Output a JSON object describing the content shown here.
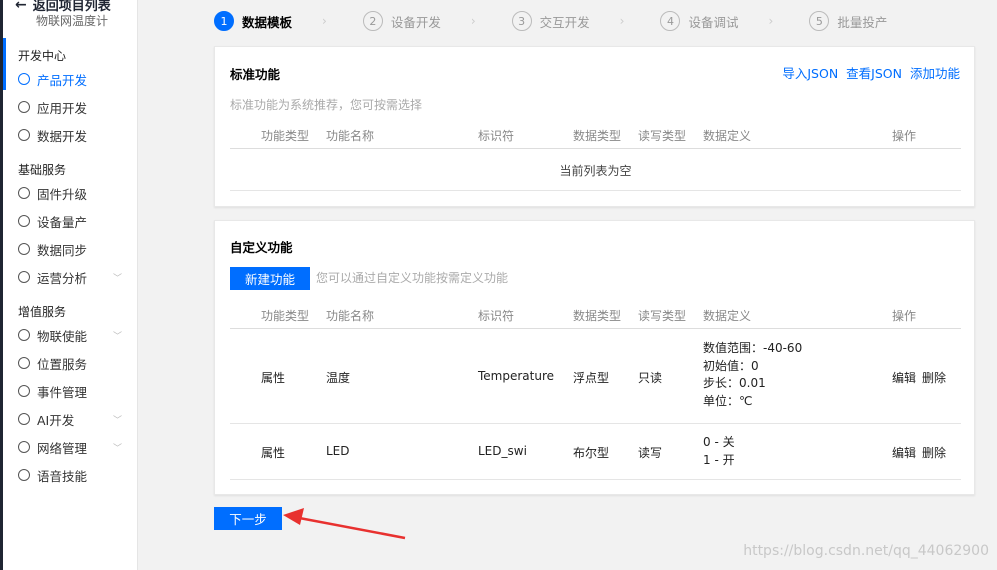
{
  "sidebar": {
    "back_label": "返回项目列表",
    "project_name": "物联网温度计",
    "groups": [
      {
        "title": "开发中心",
        "items": [
          {
            "label": "产品开发",
            "icon": "gear-icon",
            "active": true
          },
          {
            "label": "应用开发",
            "icon": "app-icon"
          },
          {
            "label": "数据开发",
            "icon": "data-icon"
          }
        ]
      },
      {
        "title": "基础服务",
        "items": [
          {
            "label": "固件升级",
            "icon": "firmware-icon"
          },
          {
            "label": "设备量产",
            "icon": "production-icon"
          },
          {
            "label": "数据同步",
            "icon": "sync-icon"
          },
          {
            "label": "运营分析",
            "icon": "analytics-icon",
            "expandable": true
          }
        ]
      },
      {
        "title": "增值服务",
        "items": [
          {
            "label": "物联使能",
            "icon": "iot-icon",
            "expandable": true
          },
          {
            "label": "位置服务",
            "icon": "location-icon"
          },
          {
            "label": "事件管理",
            "icon": "event-icon"
          },
          {
            "label": "AI开发",
            "icon": "ai-icon",
            "expandable": true
          },
          {
            "label": "网络管理",
            "icon": "network-icon",
            "expandable": true
          },
          {
            "label": "语音技能",
            "icon": "voice-icon"
          }
        ]
      }
    ]
  },
  "steps": [
    {
      "num": "1",
      "label": "数据模板",
      "active": true
    },
    {
      "num": "2",
      "label": "设备开发"
    },
    {
      "num": "3",
      "label": "交互开发"
    },
    {
      "num": "4",
      "label": "设备调试"
    },
    {
      "num": "5",
      "label": "批量投产"
    }
  ],
  "standard": {
    "title": "标准功能",
    "links": [
      "导入JSON",
      "查看JSON",
      "添加功能"
    ],
    "hint": "标准功能为系统推荐，您可按需选择",
    "empty_text": "当前列表为空"
  },
  "custom": {
    "title": "自定义功能",
    "new_button": "新建功能",
    "hint": "您可以通过自定义功能按需定义功能",
    "rows": [
      {
        "type": "属性",
        "name": "温度",
        "id": "Temperature",
        "dtype": "浮点型",
        "rw": "只读",
        "def": [
          "数值范围：-40-60",
          "初始值：0",
          "步长：0.01",
          "单位：℃"
        ],
        "edit": "编辑",
        "del": "删除"
      },
      {
        "type": "属性",
        "name": "LED",
        "id": "LED_swi",
        "dtype": "布尔型",
        "rw": "读写",
        "def": [
          "0 - 关",
          "1 - 开"
        ],
        "edit": "编辑",
        "del": "删除"
      }
    ]
  },
  "columns": [
    "功能类型",
    "功能名称",
    "标识符",
    "数据类型",
    "读写类型",
    "数据定义",
    "操作"
  ],
  "next_button": "下一步",
  "watermark": "https://blog.csdn.net/qq_44062900",
  "colors": {
    "accent": "#006eff",
    "annotation_arrow": "#e8312f"
  }
}
